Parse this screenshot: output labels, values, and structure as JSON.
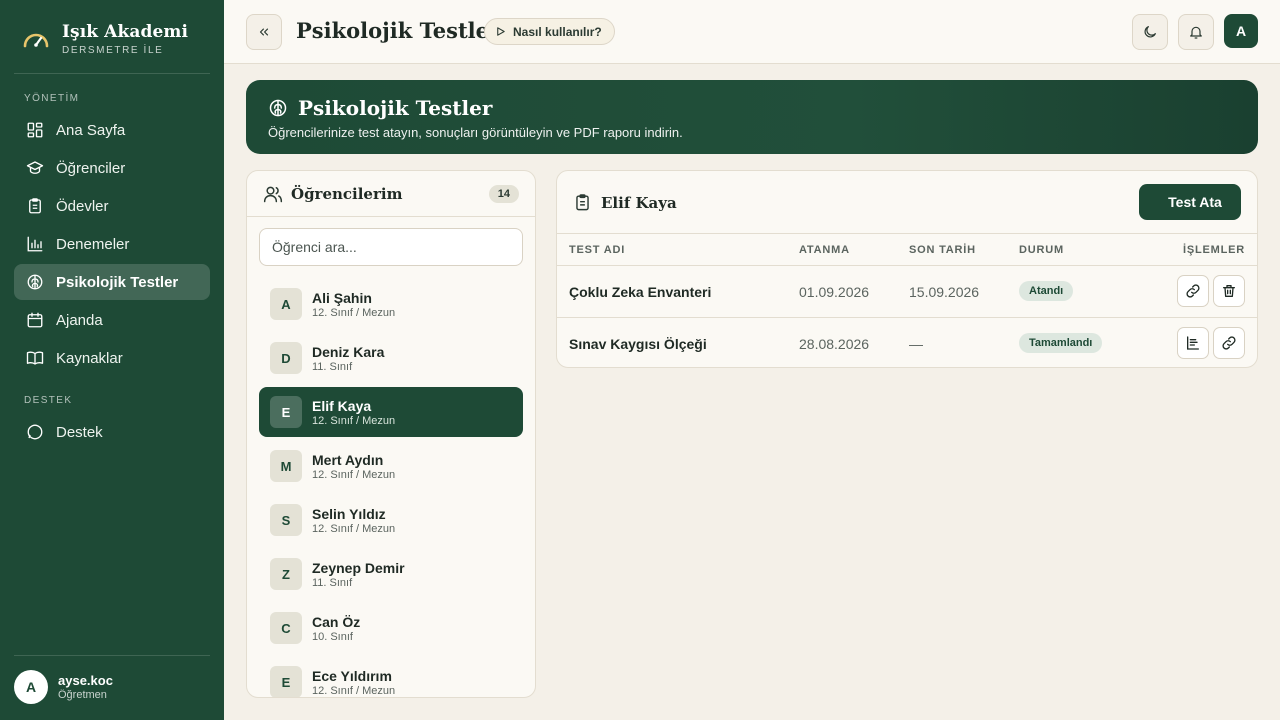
{
  "brand": {
    "title": "Işık Akademi",
    "subtitle": "DERSMETRE İLE"
  },
  "sidebar": {
    "sections": [
      "YÖNETİM",
      "DESTEK"
    ],
    "items": [
      {
        "label": "Ana Sayfa",
        "icon": "grid-icon"
      },
      {
        "label": "Öğrenciler",
        "icon": "graduation-cap-icon"
      },
      {
        "label": "Ödevler",
        "icon": "clipboard-icon"
      },
      {
        "label": "Denemeler",
        "icon": "bar-chart-icon"
      },
      {
        "label": "Psikolojik Testler",
        "icon": "brain-icon",
        "active": true
      },
      {
        "label": "Ajanda",
        "icon": "calendar-icon"
      },
      {
        "label": "Kaynaklar",
        "icon": "book-open-icon"
      },
      {
        "label": "Destek",
        "icon": "message-circle-icon"
      }
    ]
  },
  "user": {
    "initial": "A",
    "name": "ayse.koc",
    "role": "Öğretmen"
  },
  "header": {
    "title": "Psikolojik Testler",
    "help": "Nasıl kullanılır?",
    "avatar": "A"
  },
  "banner": {
    "title": "Psikolojik Testler",
    "description": "Öğrencilerinize test atayın, sonuçları görüntüleyin ve PDF raporu indirin."
  },
  "students_panel": {
    "title": "Öğrencilerim",
    "count": "14",
    "search_placeholder": "Öğrenci ara...",
    "students": [
      {
        "initial": "A",
        "name": "Ali Şahin",
        "grade": "12. Sınıf / Mezun"
      },
      {
        "initial": "D",
        "name": "Deniz Kara",
        "grade": "11. Sınıf"
      },
      {
        "initial": "E",
        "name": "Elif Kaya",
        "grade": "12. Sınıf / Mezun",
        "selected": true
      },
      {
        "initial": "M",
        "name": "Mert Aydın",
        "grade": "12. Sınıf / Mezun"
      },
      {
        "initial": "S",
        "name": "Selin Yıldız",
        "grade": "12. Sınıf / Mezun"
      },
      {
        "initial": "Z",
        "name": "Zeynep Demir",
        "grade": "11. Sınıf"
      },
      {
        "initial": "C",
        "name": "Can Öz",
        "grade": "10. Sınıf"
      },
      {
        "initial": "E",
        "name": "Ece Yıldırım",
        "grade": "12. Sınıf / Mezun"
      }
    ]
  },
  "tests_panel": {
    "student_name": "Elif Kaya",
    "assign_button": "Test Ata",
    "columns": [
      "TEST ADI",
      "ATANMA",
      "SON TARİH",
      "DURUM",
      "İŞLEMLER"
    ],
    "rows": [
      {
        "name": "Çoklu Zeka Envanteri",
        "assigned": "01.09.2026",
        "due": "15.09.2026",
        "status": "Atandı",
        "actions": [
          "link-icon",
          "trash-icon"
        ]
      },
      {
        "name": "Sınav Kaygısı Ölçeği",
        "assigned": "28.08.2026",
        "due": "—",
        "status": "Tamamlandı",
        "actions": [
          "report-icon",
          "link-icon"
        ]
      }
    ]
  },
  "colors": {
    "primary": "#1e4a36",
    "background": "#f4f0e8",
    "surface": "#fbf9f4",
    "border": "#e3ddd0",
    "status_bg": "#dde7df"
  }
}
